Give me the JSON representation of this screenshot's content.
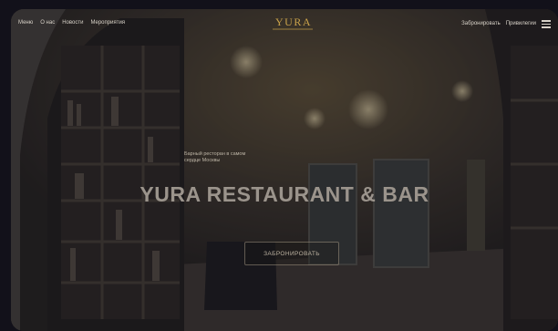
{
  "nav": {
    "left_links": [
      "Меню",
      "О нас",
      "Новости",
      "Мероприятия"
    ],
    "logo": "YURA",
    "right_links": [
      "Забронировать",
      "Привилегии"
    ],
    "menu_icon": "hamburger-menu-icon"
  },
  "hero": {
    "eyebrow": "Барный ресторан в самом сердце Москвы",
    "title": "YURA RESTAURANT & BAR",
    "cta_label": "ЗАБРОНИРОВАТЬ"
  },
  "colors": {
    "accent": "#c9a24a",
    "overlay": "#1a1820",
    "background": "#12111a"
  }
}
